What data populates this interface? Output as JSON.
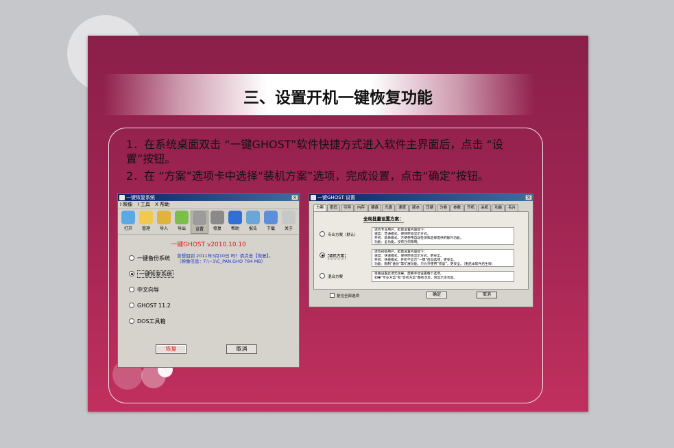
{
  "slide": {
    "title": "三、设置开机一键恢复功能",
    "step1": "1．在系统桌面双击 “一键GHOST”软件快捷方式进入软件主界面后，点击 “设置”按钮。",
    "step2": "2．在 “方案”选项卡中选择“装机方案”选项，完成设置，点击“确定”按钮。"
  },
  "window1": {
    "title": "一键恢复系统",
    "close": "×",
    "menu": [
      "I 映像",
      "I 工具",
      "X 帮助"
    ],
    "toolbar": [
      {
        "label": "打开",
        "icon": "open-icon",
        "color": "#5aa9e6"
      },
      {
        "label": "管理",
        "icon": "manage-icon",
        "color": "#f2c94c"
      },
      {
        "label": "导入",
        "icon": "import-icon",
        "color": "#e0b33a"
      },
      {
        "label": "导出",
        "icon": "export-icon",
        "color": "#7bbf4a"
      },
      {
        "label": "设置",
        "icon": "settings-icon",
        "color": "#9c9c9c"
      },
      {
        "label": "修复",
        "icon": "repair-icon",
        "color": "#8a8a8a"
      },
      {
        "label": "帮助",
        "icon": "help-icon",
        "color": "#2f6fd6"
      },
      {
        "label": "报告",
        "icon": "report-icon",
        "color": "#6aa6d8"
      },
      {
        "label": "下载",
        "icon": "download-icon",
        "color": "#5b8fd9"
      },
      {
        "label": "关于",
        "icon": "about-icon",
        "color": "#c7c7c7"
      }
    ],
    "version": "一键GHOST v2010.10.10",
    "options": [
      {
        "label": "一键备份系统",
        "checked": false
      },
      {
        "label": "一键恢复系统",
        "checked": true
      },
      {
        "label": "中文向导",
        "checked": false
      },
      {
        "label": "GHOST 11.2",
        "checked": false
      },
      {
        "label": "DOS工具箱",
        "checked": false
      }
    ],
    "info_line1": "曾想回到 2011年3月10日 吗？请点击【恢复】。",
    "info_line2": "（映像信息：F:\\~1\\C_PAN.GHO   784 MB）",
    "restore_button": "恢复",
    "cancel_button": "取消"
  },
  "window2": {
    "title": "一键GHOST 设置",
    "close": "×",
    "tabs": [
      "方案",
      "密码",
      "引导",
      "内存",
      "硬盘",
      "光盘",
      "速度",
      "版本",
      "压缩",
      "分卷",
      "参数",
      "开机",
      "关机",
      "功能",
      "名片"
    ],
    "panel_title": "全局批量设置方案：",
    "schemes": [
      {
        "label": "专业方案（默认）",
        "checked": false,
        "desc": [
          "适合专业用户，批量设置内容如下：",
          "速度：普通模式，保持原始显示方式。",
          "开机：简单模式，方便使用自动检测和选择提供的额外功能。",
          "功能：全功能，没有任何限制。"
        ]
      },
      {
        "label": "装机方案",
        "checked": true,
        "desc": [
          "适合初级用户，批量设置内容如下：",
          "速度：快速模式，保持原始显示方式，更安全。",
          "开机：快捷模式，开机不显示“一键”启动选项，更安全。",
          "功能：限制“备份”等扩展功能，只允许使用“恢复”，更安全。（重启本软件后生效）"
        ]
      },
      {
        "label": "混合方案",
        "checked": false,
        "desc": [
          "单独设置此项无效果，需要手动设置每个选项。",
          "如果“专业方案”和“装机方案”都有涉及，则显示本状态。"
        ]
      }
    ],
    "restore_all": "复位全部选项",
    "ok_button": "确定",
    "cancel_button": "取消"
  }
}
